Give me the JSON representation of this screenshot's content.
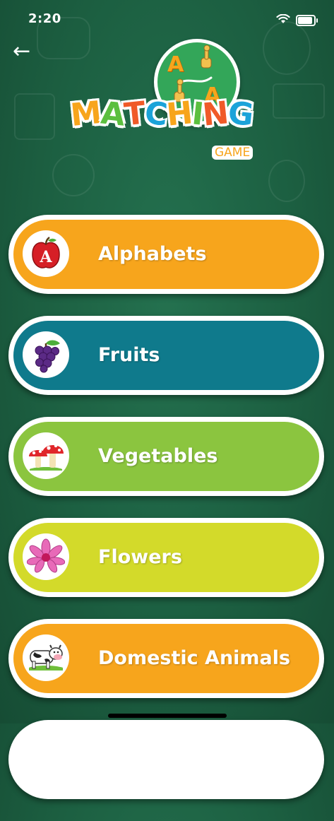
{
  "status_bar": {
    "time": "2:20",
    "battery_level": 0.85,
    "icons": [
      "wifi-icon",
      "battery-icon"
    ]
  },
  "navigation": {
    "back_icon": "arrow-left-icon",
    "back_glyph": "←"
  },
  "logo": {
    "letter_top": "A",
    "letter_bottom": "A",
    "title": "MATCHING",
    "title_colors": [
      "#f7a51c",
      "#5bbf3f",
      "#f05a28",
      "#1ba3d9",
      "#f7a51c",
      "#5bbf3f",
      "#f05a28",
      "#1ba3d9"
    ],
    "subtitle": "GAME"
  },
  "menu": {
    "items": [
      {
        "label": "Alphabets",
        "icon": "apple-letter-icon",
        "color": "#f7a51c"
      },
      {
        "label": "Fruits",
        "icon": "grapes-icon",
        "color": "#0f7a8c"
      },
      {
        "label": "Vegetables",
        "icon": "mushroom-icon",
        "color": "#8bc53f"
      },
      {
        "label": "Flowers",
        "icon": "lotus-flower-icon",
        "color": "#d3da2a"
      },
      {
        "label": "Domestic Animals",
        "icon": "cow-icon",
        "color": "#f7a51c"
      }
    ]
  },
  "colors": {
    "background": "#1c5f41",
    "accent_orange": "#f7a51c",
    "accent_teal": "#0f7a8c",
    "accent_green": "#8bc53f",
    "accent_lime": "#d3da2a"
  }
}
